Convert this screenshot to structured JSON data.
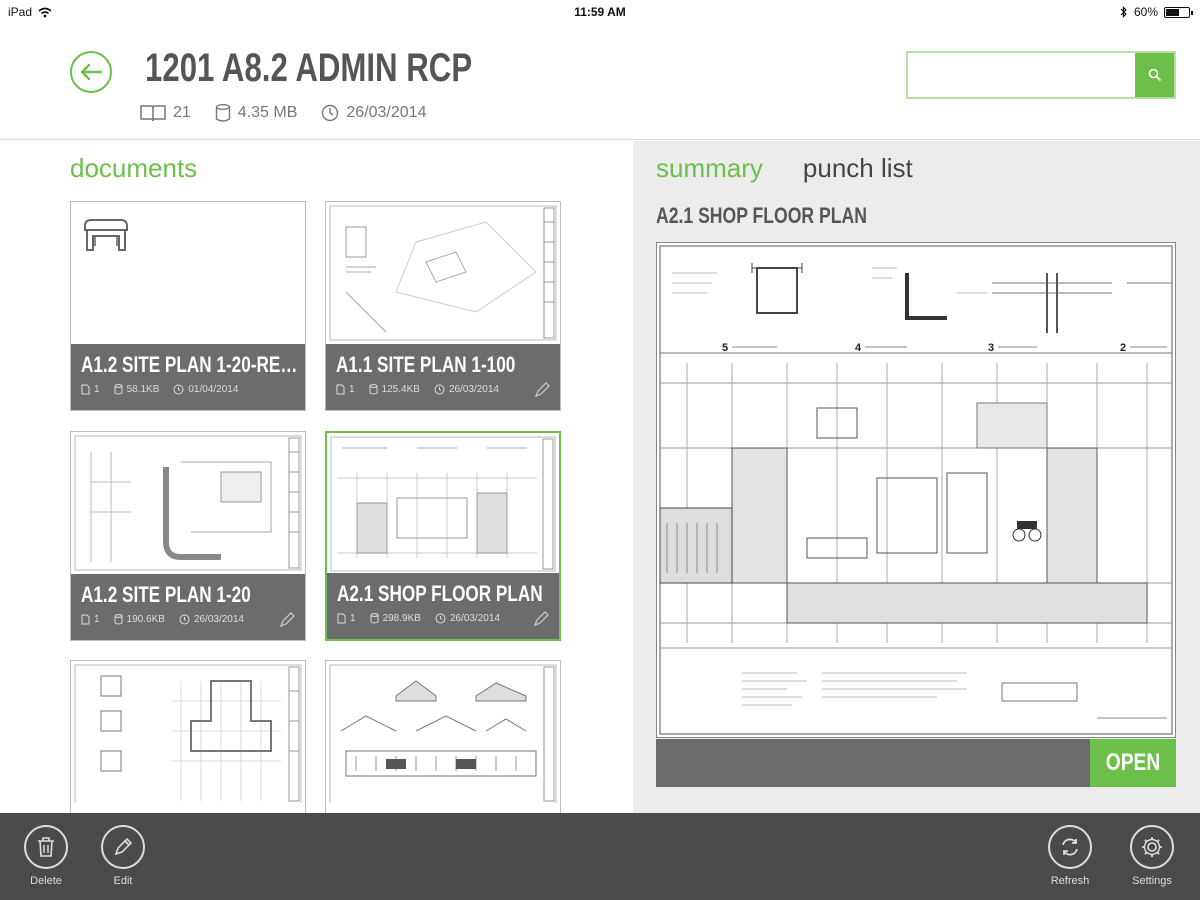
{
  "status_bar": {
    "device": "iPad",
    "time": "11:59 AM",
    "battery": "60%",
    "battery_level": 0.6
  },
  "header": {
    "title": "1201 A8.2 ADMIN RCP",
    "pages": "21",
    "size": "4.35 MB",
    "date": "26/03/2014",
    "search_placeholder": ""
  },
  "documents": {
    "section_title": "documents",
    "cards": [
      {
        "name": "A1.2 SITE PLAN 1-20-REN...",
        "pages": "1",
        "size": "58.1KB",
        "date": "01/04/2014",
        "selected": false
      },
      {
        "name": "A1.1 SITE PLAN 1-100",
        "pages": "1",
        "size": "125.4KB",
        "date": "26/03/2014",
        "selected": false
      },
      {
        "name": "A1.2 SITE PLAN 1-20",
        "pages": "1",
        "size": "190.6KB",
        "date": "26/03/2014",
        "selected": false
      },
      {
        "name": "A2.1 SHOP FLOOR PLAN",
        "pages": "1",
        "size": "298.9KB",
        "date": "26/03/2014",
        "selected": true
      },
      {
        "name": "",
        "pages": "",
        "size": "",
        "date": "",
        "selected": false
      },
      {
        "name": "",
        "pages": "",
        "size": "",
        "date": "",
        "selected": false
      }
    ]
  },
  "right_panel": {
    "tabs": [
      {
        "label": "summary",
        "active": true
      },
      {
        "label": "punch list",
        "active": false
      }
    ],
    "preview_title": "A2.1 SHOP FLOOR PLAN",
    "detail_numbers": [
      "5",
      "4",
      "3",
      "2"
    ],
    "open_label": "OPEN"
  },
  "toolbar": {
    "delete_label": "Delete",
    "edit_label": "Edit",
    "refresh_label": "Refresh",
    "settings_label": "Settings"
  },
  "colors": {
    "accent": "#6cc04a",
    "dark_bar": "#4a4a4a",
    "card_footer": "#6c6c6c",
    "panel_bg": "#ececec"
  }
}
